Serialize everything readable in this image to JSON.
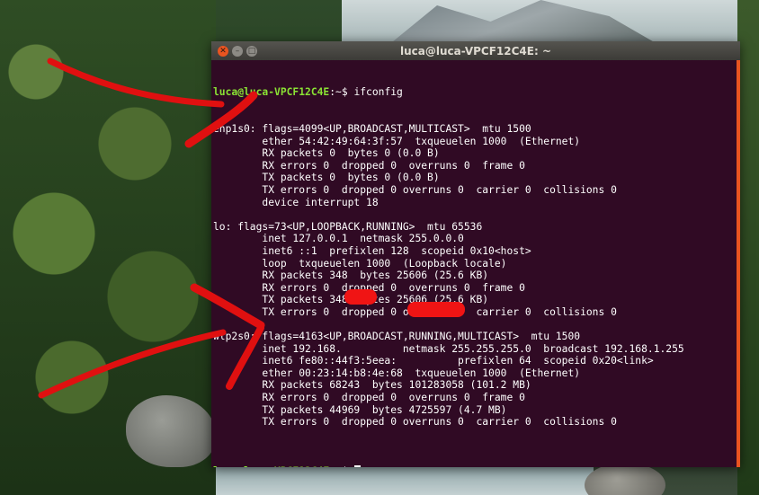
{
  "window": {
    "title": "luca@luca-VPCF12C4E: ~",
    "close_glyph": "✕",
    "minimize_glyph": "–",
    "maximize_glyph": "□"
  },
  "terminal": {
    "prompt_user": "luca@luca-VPCF12C4E",
    "prompt_suffix": ":~$ ",
    "command": "ifconfig",
    "lines": [
      "enp1s0: flags=4099<UP,BROADCAST,MULTICAST>  mtu 1500",
      "        ether 54:42:49:64:3f:57  txqueuelen 1000  (Ethernet)",
      "        RX packets 0  bytes 0 (0.0 B)",
      "        RX errors 0  dropped 0  overruns 0  frame 0",
      "        TX packets 0  bytes 0 (0.0 B)",
      "        TX errors 0  dropped 0 overruns 0  carrier 0  collisions 0",
      "        device interrupt 18",
      "",
      "lo: flags=73<UP,LOOPBACK,RUNNING>  mtu 65536",
      "        inet 127.0.0.1  netmask 255.0.0.0",
      "        inet6 ::1  prefixlen 128  scopeid 0x10<host>",
      "        loop  txqueuelen 1000  (Loopback locale)",
      "        RX packets 348  bytes 25606 (25.6 KB)",
      "        RX errors 0  dropped 0  overruns 0  frame 0",
      "        TX packets 348  bytes 25606 (25.6 KB)",
      "        TX errors 0  dropped 0 overruns 0  carrier 0  collisions 0",
      "",
      "wlp2s0: flags=4163<UP,BROADCAST,RUNNING,MULTICAST>  mtu 1500",
      "        inet 192.168.          netmask 255.255.255.0  broadcast 192.168.1.255",
      "        inet6 fe80::44f3:5eea:          prefixlen 64  scopeid 0x20<link>",
      "        ether 00:23:14:b8:4e:68  txqueuelen 1000  (Ethernet)",
      "        RX packets 68243  bytes 101283058 (101.2 MB)",
      "        RX errors 0  dropped 0  overruns 0  frame 0",
      "        TX packets 44969  bytes 4725597 (4.7 MB)",
      "        TX errors 0  dropped 0 overruns 0  carrier 0  collisions 0",
      ""
    ]
  },
  "colors": {
    "terminal_bg": "#300a24",
    "prompt_green": "#8ae234",
    "accent_orange": "#e95420",
    "annotation_red": "#e01010"
  }
}
